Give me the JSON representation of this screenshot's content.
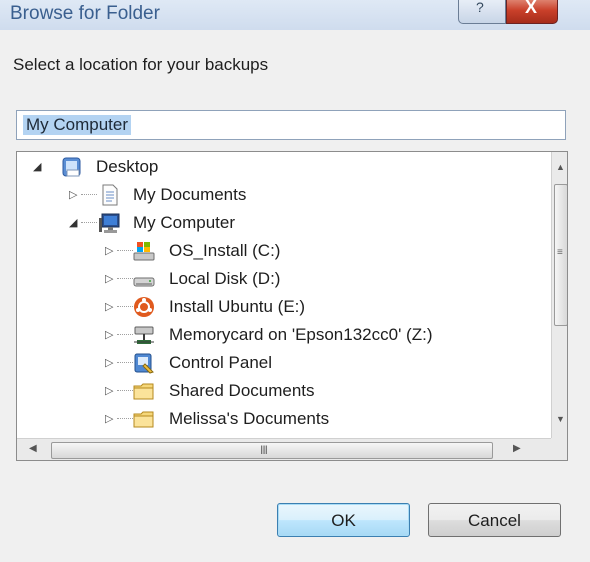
{
  "window": {
    "title": "Browse for Folder",
    "help_glyph": "?",
    "close_glyph": "X"
  },
  "prompt": "Select a location for your backups",
  "path_field": {
    "value": "My Computer"
  },
  "tree": {
    "root": {
      "label": "Desktop",
      "icon": "desktop-icon",
      "expanded": true
    },
    "level1": [
      {
        "label": "My Documents",
        "icon": "documents-icon",
        "expanded": false
      },
      {
        "label": "My Computer",
        "icon": "computer-icon",
        "expanded": true
      }
    ],
    "computer_children": [
      {
        "label": "OS_Install (C:)",
        "icon": "system-drive-icon"
      },
      {
        "label": "Local Disk (D:)",
        "icon": "disk-drive-icon"
      },
      {
        "label": "Install Ubuntu (E:)",
        "icon": "ubuntu-disk-icon"
      },
      {
        "label": "Memorycard on 'Epson132cc0' (Z:)",
        "icon": "network-drive-icon"
      },
      {
        "label": "Control Panel",
        "icon": "control-panel-icon"
      },
      {
        "label": "Shared Documents",
        "icon": "folder-icon"
      },
      {
        "label": "Melissa's Documents",
        "icon": "folder-icon"
      }
    ]
  },
  "scrollbars": {
    "vertical_grip": "≡",
    "horizontal_grip": "III"
  },
  "buttons": {
    "ok_label": "OK",
    "cancel_label": "Cancel"
  }
}
